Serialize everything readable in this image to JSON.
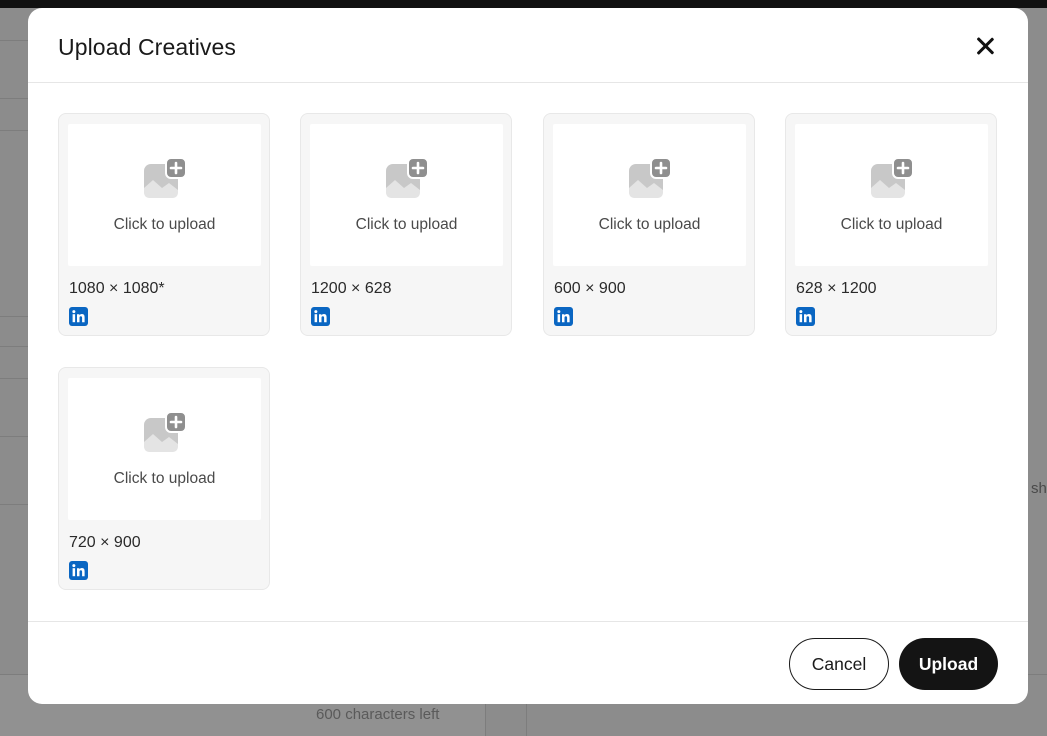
{
  "background": {
    "characters_left": "600 characters left",
    "right_fragment": "sh"
  },
  "modal": {
    "title": "Upload Creatives",
    "close_icon": "close-icon"
  },
  "slots": [
    {
      "size": "1080 × 1080*",
      "upload_label": "Click to upload",
      "platform_icon": "linkedin-icon"
    },
    {
      "size": "1200 × 628",
      "upload_label": "Click to upload",
      "platform_icon": "linkedin-icon"
    },
    {
      "size": "600 × 900",
      "upload_label": "Click to upload",
      "platform_icon": "linkedin-icon"
    },
    {
      "size": "628 × 1200",
      "upload_label": "Click to upload",
      "platform_icon": "linkedin-icon"
    },
    {
      "size": "720 × 900",
      "upload_label": "Click to upload",
      "platform_icon": "linkedin-icon"
    }
  ],
  "footer": {
    "cancel_label": "Cancel",
    "upload_label": "Upload"
  },
  "colors": {
    "linkedin": "#0a66c2",
    "primary_button": "#141414",
    "overlay": "#8c8c8c"
  }
}
